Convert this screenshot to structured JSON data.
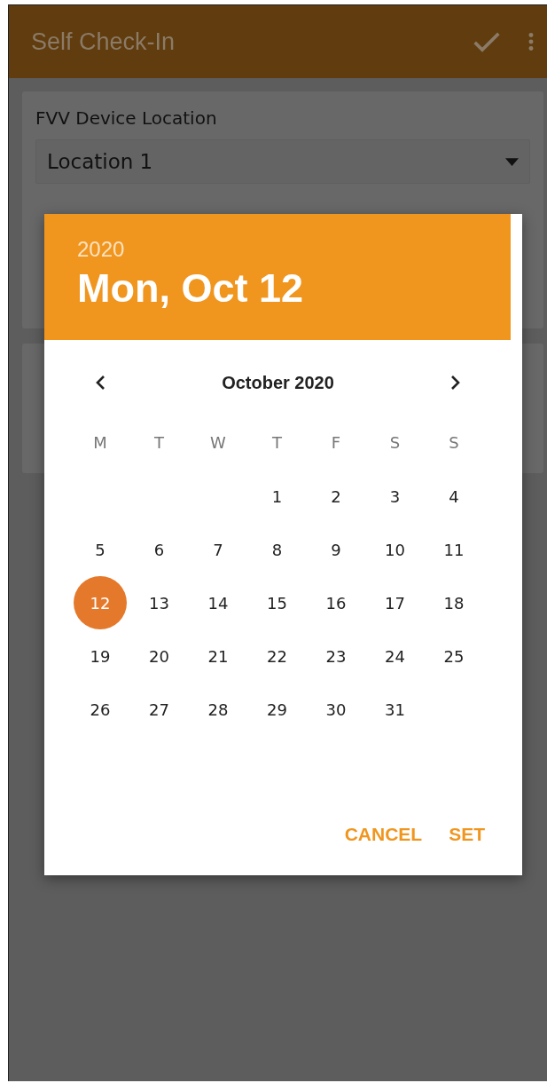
{
  "app_bar": {
    "title": "Self Check-In"
  },
  "form": {
    "location_label": "FVV Device Location",
    "location_value": "Location 1"
  },
  "date_picker": {
    "year": "2020",
    "date": "Mon, Oct 12",
    "month": "October 2020",
    "weekdays": [
      "M",
      "T",
      "W",
      "T",
      "F",
      "S",
      "S"
    ],
    "cells": [
      {
        "kind": "blank"
      },
      {
        "kind": "blank"
      },
      {
        "kind": "blank"
      },
      {
        "kind": "day",
        "label": "1",
        "selected": false
      },
      {
        "kind": "day",
        "label": "2",
        "selected": false
      },
      {
        "kind": "day",
        "label": "3",
        "selected": false
      },
      {
        "kind": "day",
        "label": "4",
        "selected": false
      },
      {
        "kind": "day",
        "label": "5",
        "selected": false
      },
      {
        "kind": "day",
        "label": "6",
        "selected": false
      },
      {
        "kind": "day",
        "label": "7",
        "selected": false
      },
      {
        "kind": "day",
        "label": "8",
        "selected": false
      },
      {
        "kind": "day",
        "label": "9",
        "selected": false
      },
      {
        "kind": "day",
        "label": "10",
        "selected": false
      },
      {
        "kind": "day",
        "label": "11",
        "selected": false
      },
      {
        "kind": "day",
        "label": "12",
        "selected": true
      },
      {
        "kind": "day",
        "label": "13",
        "selected": false
      },
      {
        "kind": "day",
        "label": "14",
        "selected": false
      },
      {
        "kind": "day",
        "label": "15",
        "selected": false
      },
      {
        "kind": "day",
        "label": "16",
        "selected": false
      },
      {
        "kind": "day",
        "label": "17",
        "selected": false
      },
      {
        "kind": "day",
        "label": "18",
        "selected": false
      },
      {
        "kind": "day",
        "label": "19",
        "selected": false
      },
      {
        "kind": "day",
        "label": "20",
        "selected": false
      },
      {
        "kind": "day",
        "label": "21",
        "selected": false
      },
      {
        "kind": "day",
        "label": "22",
        "selected": false
      },
      {
        "kind": "day",
        "label": "23",
        "selected": false
      },
      {
        "kind": "day",
        "label": "24",
        "selected": false
      },
      {
        "kind": "day",
        "label": "25",
        "selected": false
      },
      {
        "kind": "day",
        "label": "26",
        "selected": false
      },
      {
        "kind": "day",
        "label": "27",
        "selected": false
      },
      {
        "kind": "day",
        "label": "28",
        "selected": false
      },
      {
        "kind": "day",
        "label": "29",
        "selected": false
      },
      {
        "kind": "day",
        "label": "30",
        "selected": false
      },
      {
        "kind": "day",
        "label": "31",
        "selected": false
      }
    ],
    "buttons": [
      "CANCEL",
      "SET"
    ]
  }
}
